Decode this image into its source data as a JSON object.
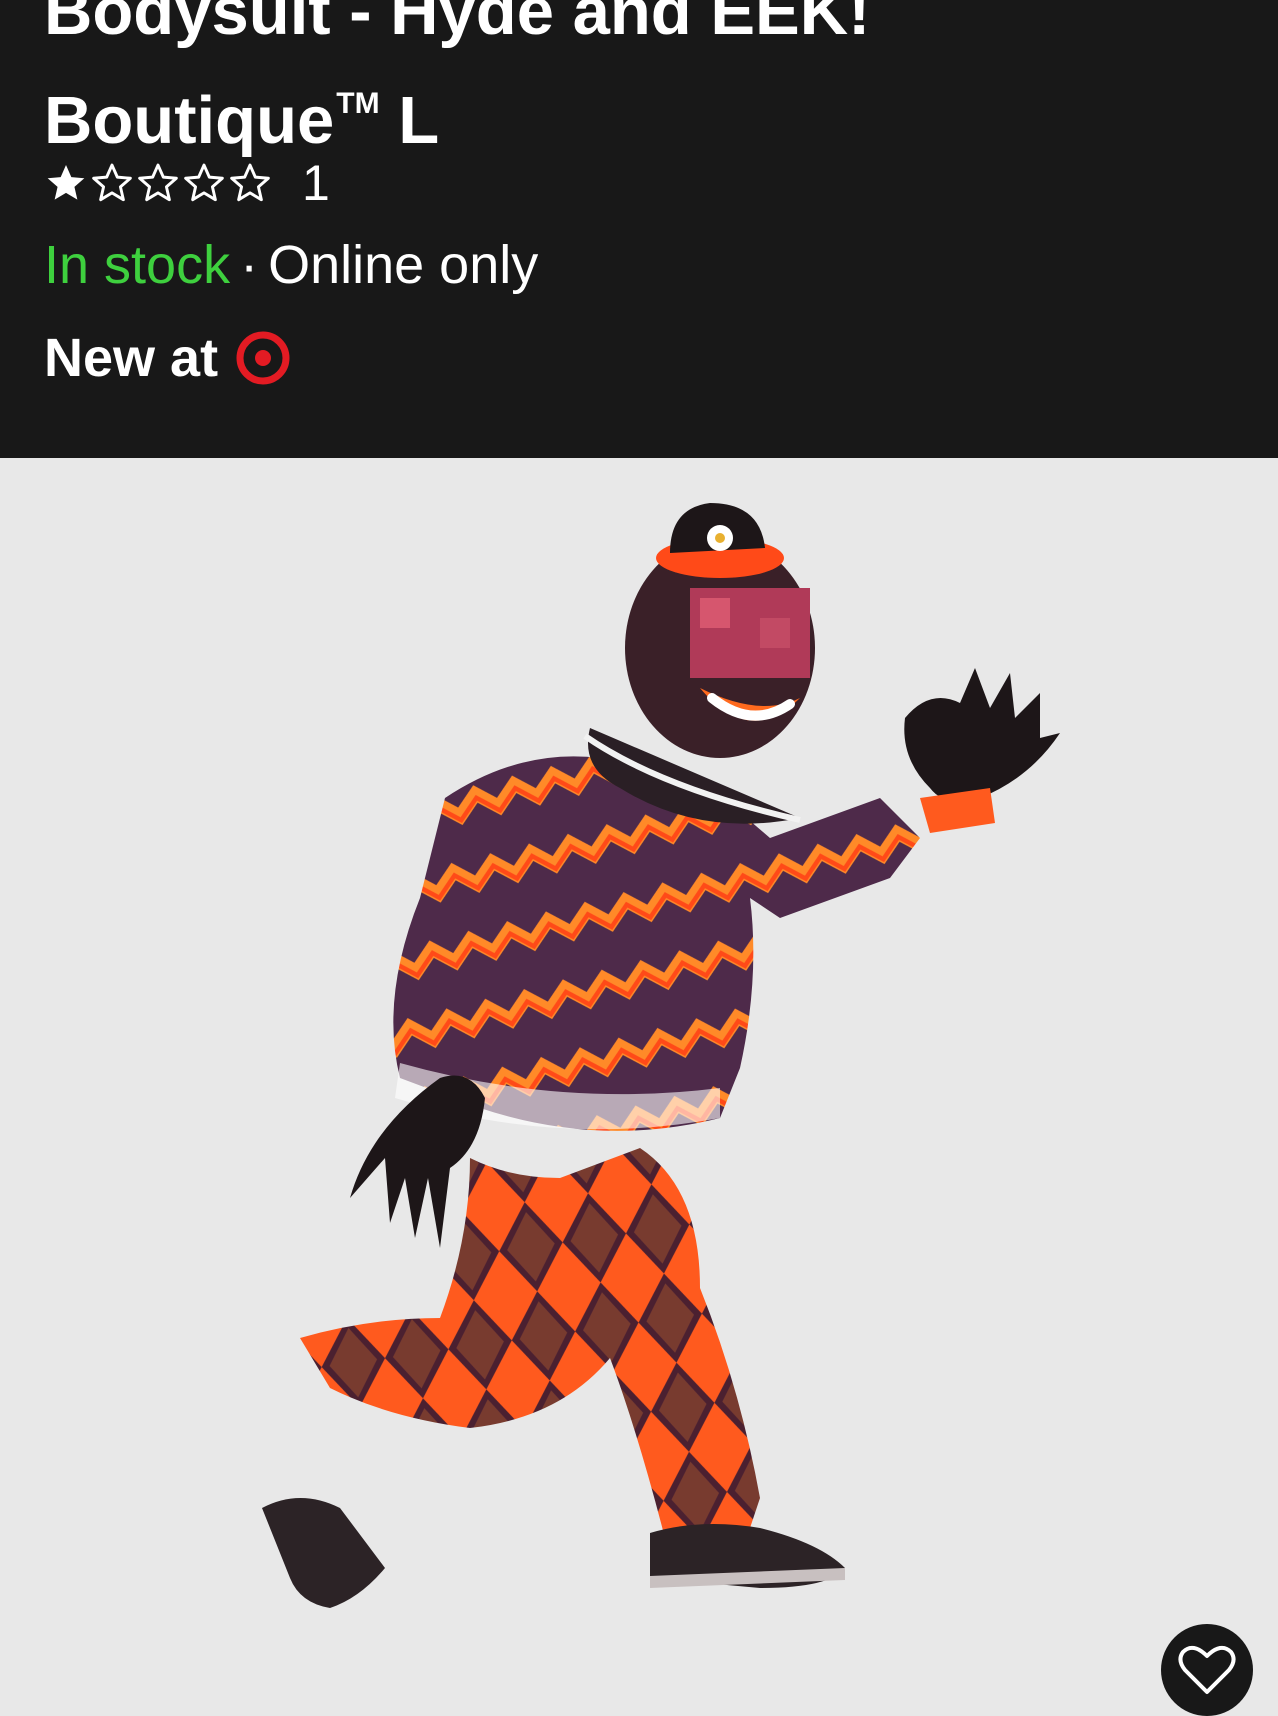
{
  "product": {
    "title": "Bodysuit - Hyde and EEK! Boutique",
    "title_line1": "Bodysuit - Hyde and EEK!",
    "title_line2": "Boutique",
    "title_tm": "TM",
    "title_size": "L",
    "rating": {
      "stars_filled": 1,
      "stars_total": 5,
      "count": "1"
    },
    "availability": {
      "status": "In stock",
      "separator": "·",
      "channel": "Online only"
    },
    "new_at": "New at",
    "image": {
      "description_hidden": true
    }
  },
  "colors": {
    "header_bg": "#181818",
    "in_stock": "#3ed03e",
    "target_red": "#e31b23",
    "image_bg": "#e8e8e8"
  },
  "icons": {
    "star_filled": "star-filled-icon",
    "star_empty": "star-outline-icon",
    "brand": "target-logo-icon",
    "favorite": "heart-icon"
  }
}
